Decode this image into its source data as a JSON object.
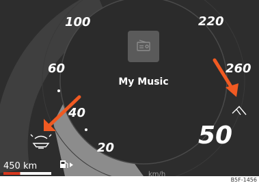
{
  "speedometer": {
    "scale_labels": [
      "100",
      "220",
      "60",
      "260",
      "40",
      "20"
    ],
    "current_speed": "50",
    "unit": "km/h"
  },
  "media": {
    "source_title": "My Music",
    "source_icon": "radio-icon"
  },
  "range": {
    "value": "450 km",
    "fuel_icon": "fuel-pump-icon",
    "indicator_icon": "play-triangle-icon",
    "bar_level": 0.35
  },
  "warning": {
    "traction_icon": "distance-warning-icon",
    "right_icon": "seatbelt-icon"
  },
  "figure_code": "B5F-1456",
  "colors": {
    "background": "#2d2d2d",
    "arc_light": "#8c8c8c",
    "arc_dark": "#4a4a4a",
    "accent_orange": "#f05a22",
    "range_bar": "#d9381e"
  }
}
